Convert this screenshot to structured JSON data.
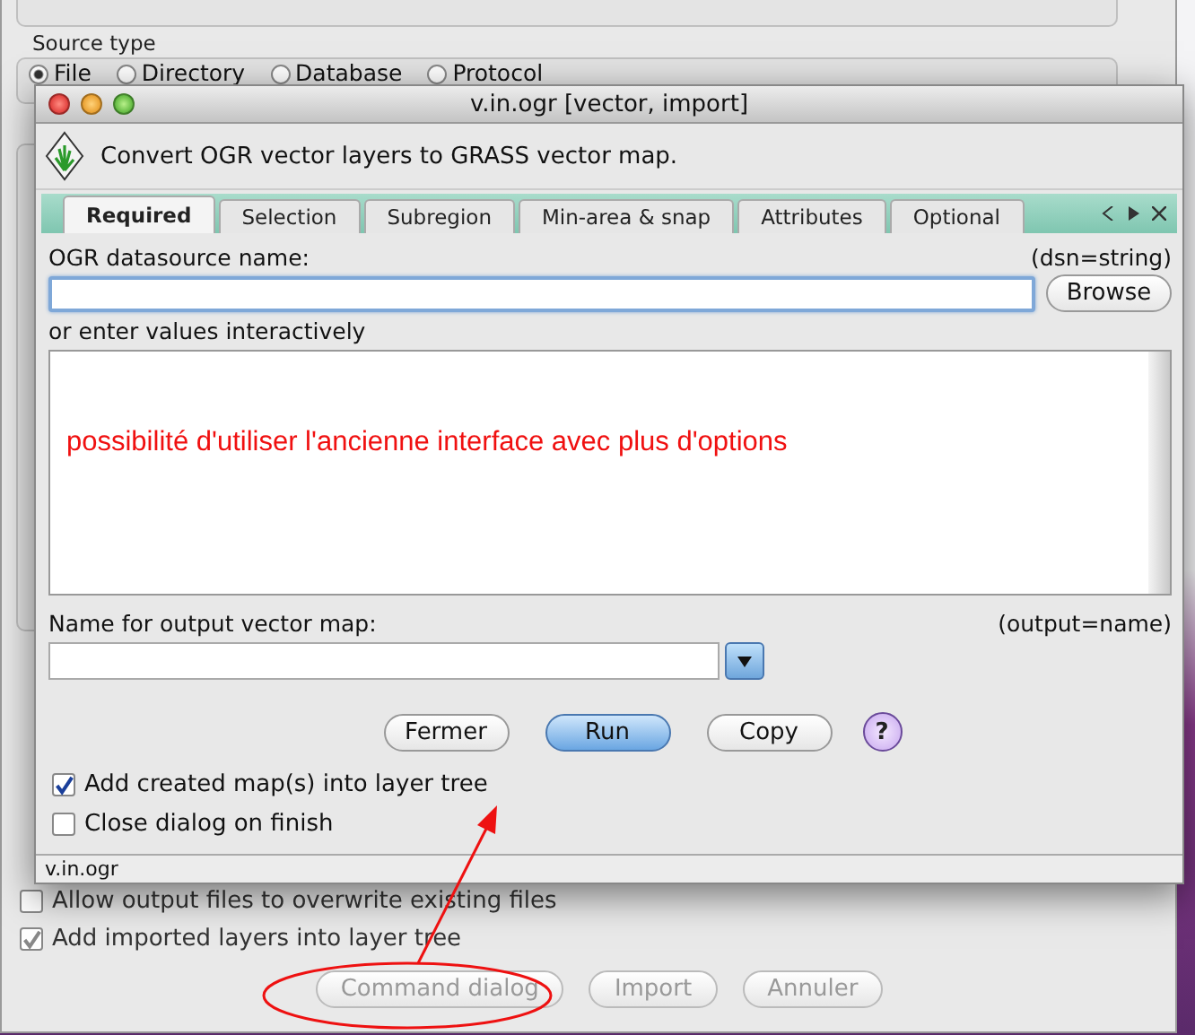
{
  "background_window": {
    "source_type_label": "Source type",
    "source_types": [
      {
        "label": "File",
        "selected": true
      },
      {
        "label": "Directory",
        "selected": false
      },
      {
        "label": "Database",
        "selected": false
      },
      {
        "label": "Protocol",
        "selected": false
      }
    ],
    "options": [
      {
        "label": "Allow output files to overwrite existing files",
        "checked": false
      },
      {
        "label": "Add imported layers into layer tree",
        "checked": true
      }
    ],
    "buttons": [
      {
        "label": "Command dialog",
        "disabled": true
      },
      {
        "label": "Import",
        "disabled": true
      },
      {
        "label": "Annuler",
        "disabled": true
      }
    ]
  },
  "dialog": {
    "title": "v.in.ogr [vector, import]",
    "description": "Convert OGR vector layers to GRASS vector map.",
    "tabs": [
      {
        "label": "Required",
        "selected": true
      },
      {
        "label": "Selection",
        "selected": false
      },
      {
        "label": "Subregion",
        "selected": false
      },
      {
        "label": "Min-area & snap",
        "selected": false
      },
      {
        "label": "Attributes",
        "selected": false
      },
      {
        "label": "Optional",
        "selected": false
      }
    ],
    "dsn": {
      "label": "OGR datasource name:",
      "hint": "(dsn=string)",
      "button": "Browse"
    },
    "interactive_label": "or enter values interactively",
    "annotation_note": "possibilité d'utiliser l'ancienne interface avec plus d'options",
    "output": {
      "label": "Name for output vector map:",
      "hint": "(output=name)"
    },
    "buttons": [
      {
        "label": "Fermer",
        "kind": "normal"
      },
      {
        "label": "Run",
        "kind": "default"
      },
      {
        "label": "Copy",
        "kind": "normal"
      },
      {
        "label": "?",
        "kind": "help"
      }
    ],
    "options": [
      {
        "label": "Add created map(s) into layer tree",
        "checked": true
      },
      {
        "label": "Close dialog on finish",
        "checked": false
      }
    ],
    "status": "v.in.ogr"
  }
}
